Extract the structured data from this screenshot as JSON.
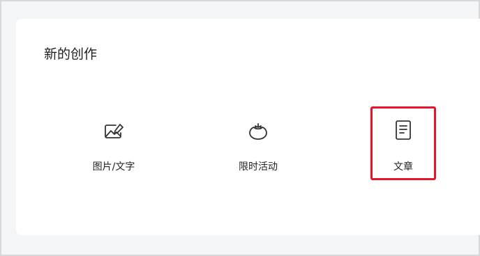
{
  "card": {
    "title": "新的创作"
  },
  "options": [
    {
      "label": "图片/文字",
      "icon": "image-edit-icon"
    },
    {
      "label": "限时活动",
      "icon": "tomato-icon"
    },
    {
      "label": "文章",
      "icon": "document-icon",
      "highlighted": true
    }
  ],
  "colors": {
    "highlight_border": "#e8142a",
    "icon_stroke": "#333333",
    "background": "#f4f5f6",
    "card": "#ffffff"
  }
}
